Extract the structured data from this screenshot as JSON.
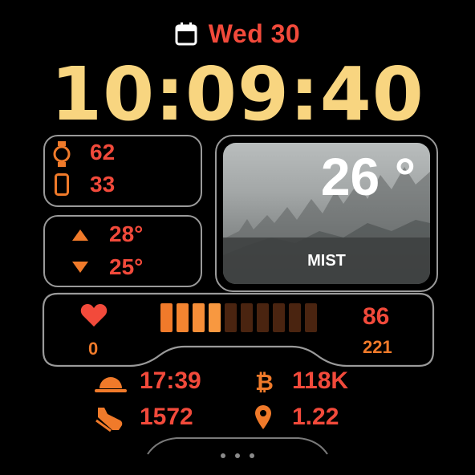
{
  "colors": {
    "accent_red": "#f24a3b",
    "accent_orange": "#f07a2a",
    "time_yellow": "#f8d580",
    "outline": "#9a9a9a",
    "seg_off": "#4a2410"
  },
  "date": {
    "icon": "calendar-icon",
    "label": "Wed 30"
  },
  "time": {
    "label": "10:09:40"
  },
  "battery": {
    "watch_icon": "watch-icon",
    "watch_value": "62",
    "phone_icon": "phone-icon",
    "phone_value": "33"
  },
  "temps": {
    "high_icon": "triangle-up-icon",
    "high": "28°",
    "low_icon": "triangle-down-icon",
    "low": "25°"
  },
  "weather": {
    "temperature": "26 °",
    "condition": "MIST"
  },
  "heart": {
    "icon": "heart-icon",
    "min": "0",
    "current": "86",
    "max": "221",
    "level_fraction": 0.4,
    "segments_total": 10
  },
  "stats": {
    "sunrise_icon": "sunrise-icon",
    "sunrise": "17:39",
    "bitcoin_icon": "bitcoin-icon",
    "bitcoin": "118K",
    "steps_icon": "shoe-icon",
    "steps": "1572",
    "distance_icon": "location-pin-icon",
    "distance": "1.22"
  },
  "pager": {
    "dots": 3
  }
}
